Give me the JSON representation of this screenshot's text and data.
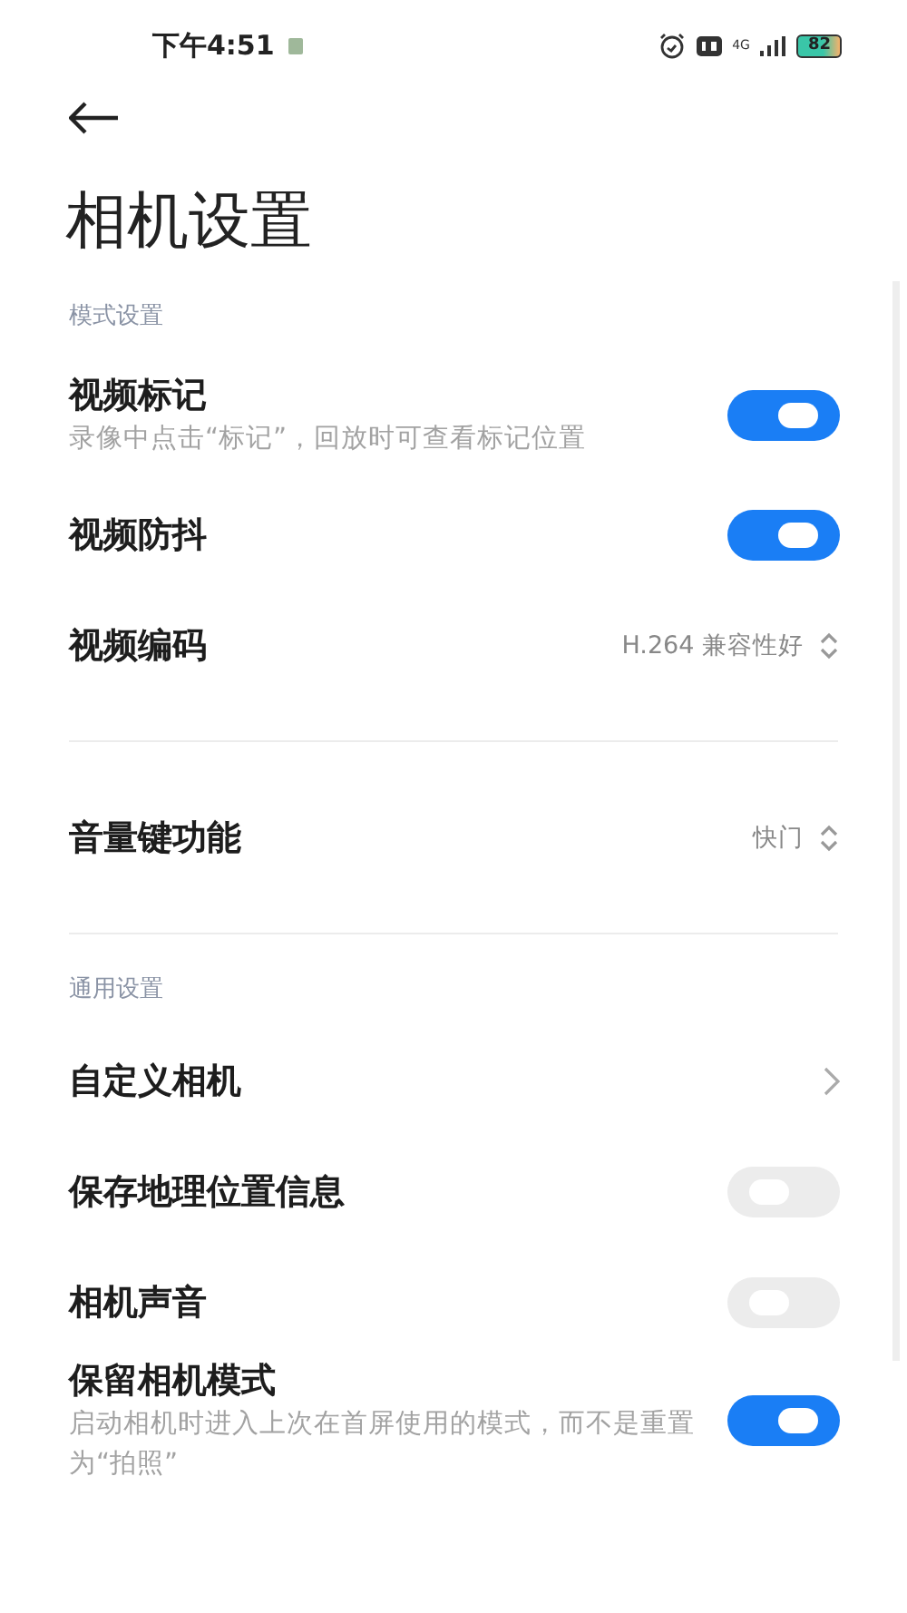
{
  "status_bar": {
    "time": "下午4:51",
    "network": "4G",
    "battery": "82"
  },
  "title": "相机设置",
  "sections": [
    {
      "title": "模式设置",
      "groups": [
        [
          {
            "kind": "toggle",
            "label": "视频标记",
            "subtitle": "录像中点击“标记”，回放时可查看标记位置",
            "on": true
          },
          {
            "kind": "toggle",
            "label": "视频防抖",
            "on": true
          },
          {
            "kind": "select",
            "label": "视频编码",
            "value": "H.264 兼容性好"
          }
        ],
        [
          {
            "kind": "select",
            "label": "音量键功能",
            "value": "快门"
          }
        ]
      ]
    },
    {
      "title": "通用设置",
      "groups": [
        [
          {
            "kind": "link",
            "label": "自定义相机"
          },
          {
            "kind": "toggle",
            "label": "保存地理位置信息",
            "on": false
          },
          {
            "kind": "toggle",
            "label": "相机声音",
            "on": false
          },
          {
            "kind": "toggle",
            "label": "保留相机模式",
            "subtitle": "启动相机时进入上次在首屏使用的模式，而不是重置为“拍照”",
            "on": true
          }
        ]
      ]
    }
  ]
}
